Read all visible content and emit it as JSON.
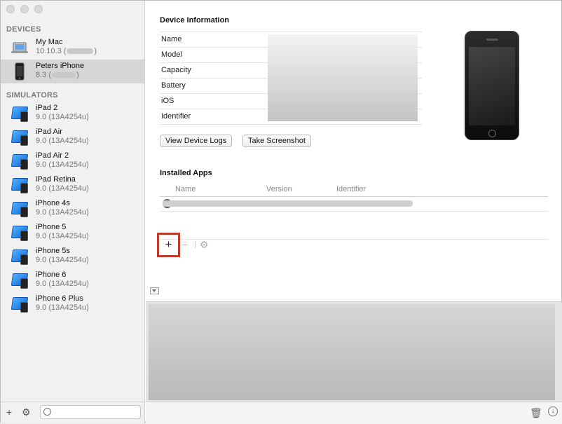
{
  "sidebar": {
    "devices_title": "DEVICES",
    "devices": [
      {
        "name": "My Mac",
        "version": "10.10.3 (",
        "version_tail": ")"
      },
      {
        "name": "Peters iPhone",
        "version": "8.3 (",
        "version_tail": ")"
      }
    ],
    "simulators_title": "SIMULATORS",
    "simulators": [
      {
        "name": "iPad 2",
        "version": "9.0 (13A4254u)"
      },
      {
        "name": "iPad Air",
        "version": "9.0 (13A4254u)"
      },
      {
        "name": "iPad Air 2",
        "version": "9.0 (13A4254u)"
      },
      {
        "name": "iPad Retina",
        "version": "9.0 (13A4254u)"
      },
      {
        "name": "iPhone 4s",
        "version": "9.0 (13A4254u)"
      },
      {
        "name": "iPhone 5",
        "version": "9.0 (13A4254u)"
      },
      {
        "name": "iPhone 5s",
        "version": "9.0 (13A4254u)"
      },
      {
        "name": "iPhone 6",
        "version": "9.0 (13A4254u)"
      },
      {
        "name": "iPhone 6 Plus",
        "version": "9.0 (13A4254u)"
      }
    ],
    "footer": {
      "add_symbol": "+",
      "gear_symbol": "⚙",
      "filter_placeholder": ""
    }
  },
  "device_info": {
    "title": "Device Information",
    "rows": [
      "Name",
      "Model",
      "Capacity",
      "Battery",
      "iOS",
      "Identifier"
    ],
    "view_logs_button": "View Device Logs",
    "screenshot_button": "Take Screenshot"
  },
  "installed_apps": {
    "title": "Installed Apps",
    "columns": {
      "name": "Name",
      "version": "Version",
      "identifier": "Identifier"
    },
    "add_symbol": "+",
    "remove_symbol": "−",
    "settings_symbol": "⚙"
  },
  "bottom_bar": {
    "trash_symbol": "🗑",
    "download_symbol": "↓"
  },
  "colors": {
    "highlight": "#c0392b",
    "selected_row": "#d6d6d6"
  }
}
